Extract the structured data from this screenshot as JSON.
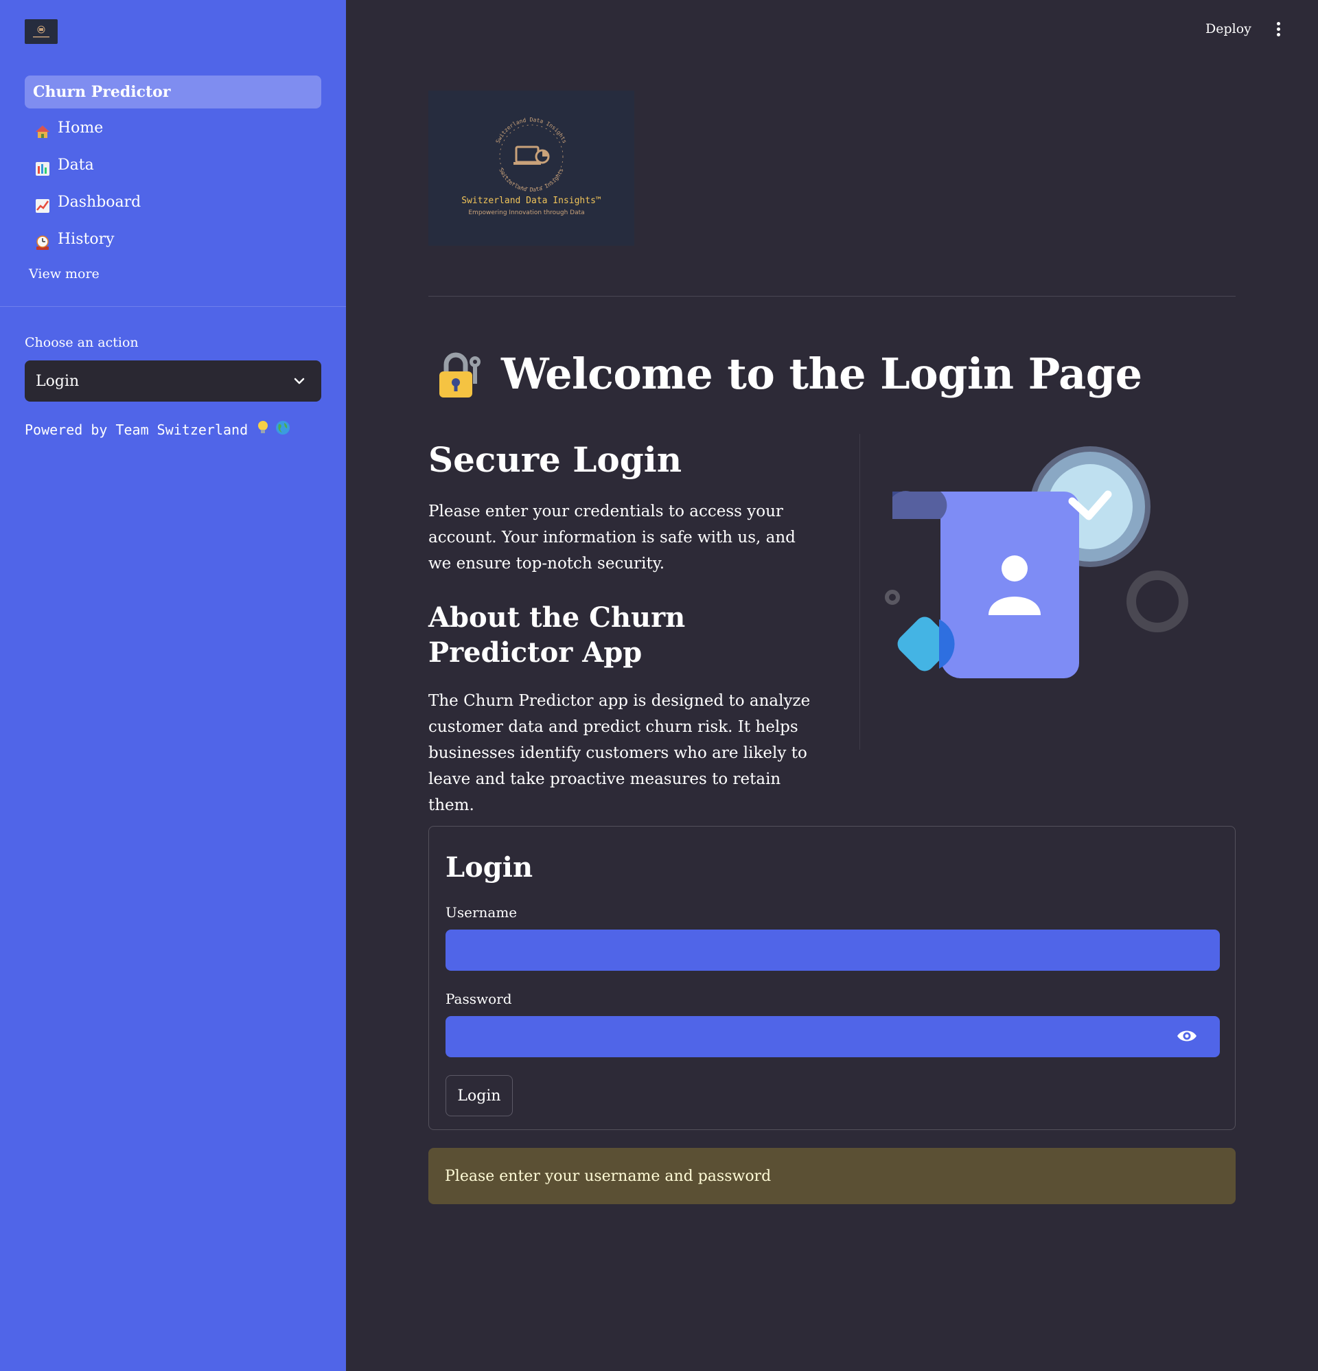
{
  "topbar": {
    "deploy_label": "Deploy"
  },
  "sidebar": {
    "header_label": "Churn Predictor",
    "items": [
      {
        "label": "Home",
        "icon": "house-icon"
      },
      {
        "label": "Data",
        "icon": "bar-chart-icon"
      },
      {
        "label": "Dashboard",
        "icon": "trend-chart-icon"
      },
      {
        "label": "History",
        "icon": "clock-icon"
      }
    ],
    "view_more_label": "View more",
    "action_label": "Choose an action",
    "action_selected": "Login",
    "powered_text": "Powered by Team Switzerland"
  },
  "brand": {
    "name": "Switzerland Data Insights™",
    "tagline": "Empowering Innovation through Data",
    "ring_text": "Switzerland Data Insights"
  },
  "main": {
    "title": "Welcome to the Login Page",
    "secure_heading": "Secure Login",
    "secure_text": "Please enter your credentials to access your account. Your information is safe with us, and we ensure top-notch security.",
    "about_heading": "About the Churn Predictor App",
    "about_text": "The Churn Predictor app is designed to analyze customer data and predict churn risk. It helps businesses identify customers who are likely to leave and take proactive measures to retain them."
  },
  "login_form": {
    "title": "Login",
    "username_label": "Username",
    "username_value": "",
    "password_label": "Password",
    "password_value": "",
    "submit_label": "Login"
  },
  "alert": {
    "message": "Please enter your username and password"
  },
  "colors": {
    "sidebar_bg": "#5065e8",
    "main_bg": "#2d2a37",
    "input_bg": "#5065e8",
    "warning_bg": "#5b5034",
    "accent_yellow": "#f5c342"
  }
}
